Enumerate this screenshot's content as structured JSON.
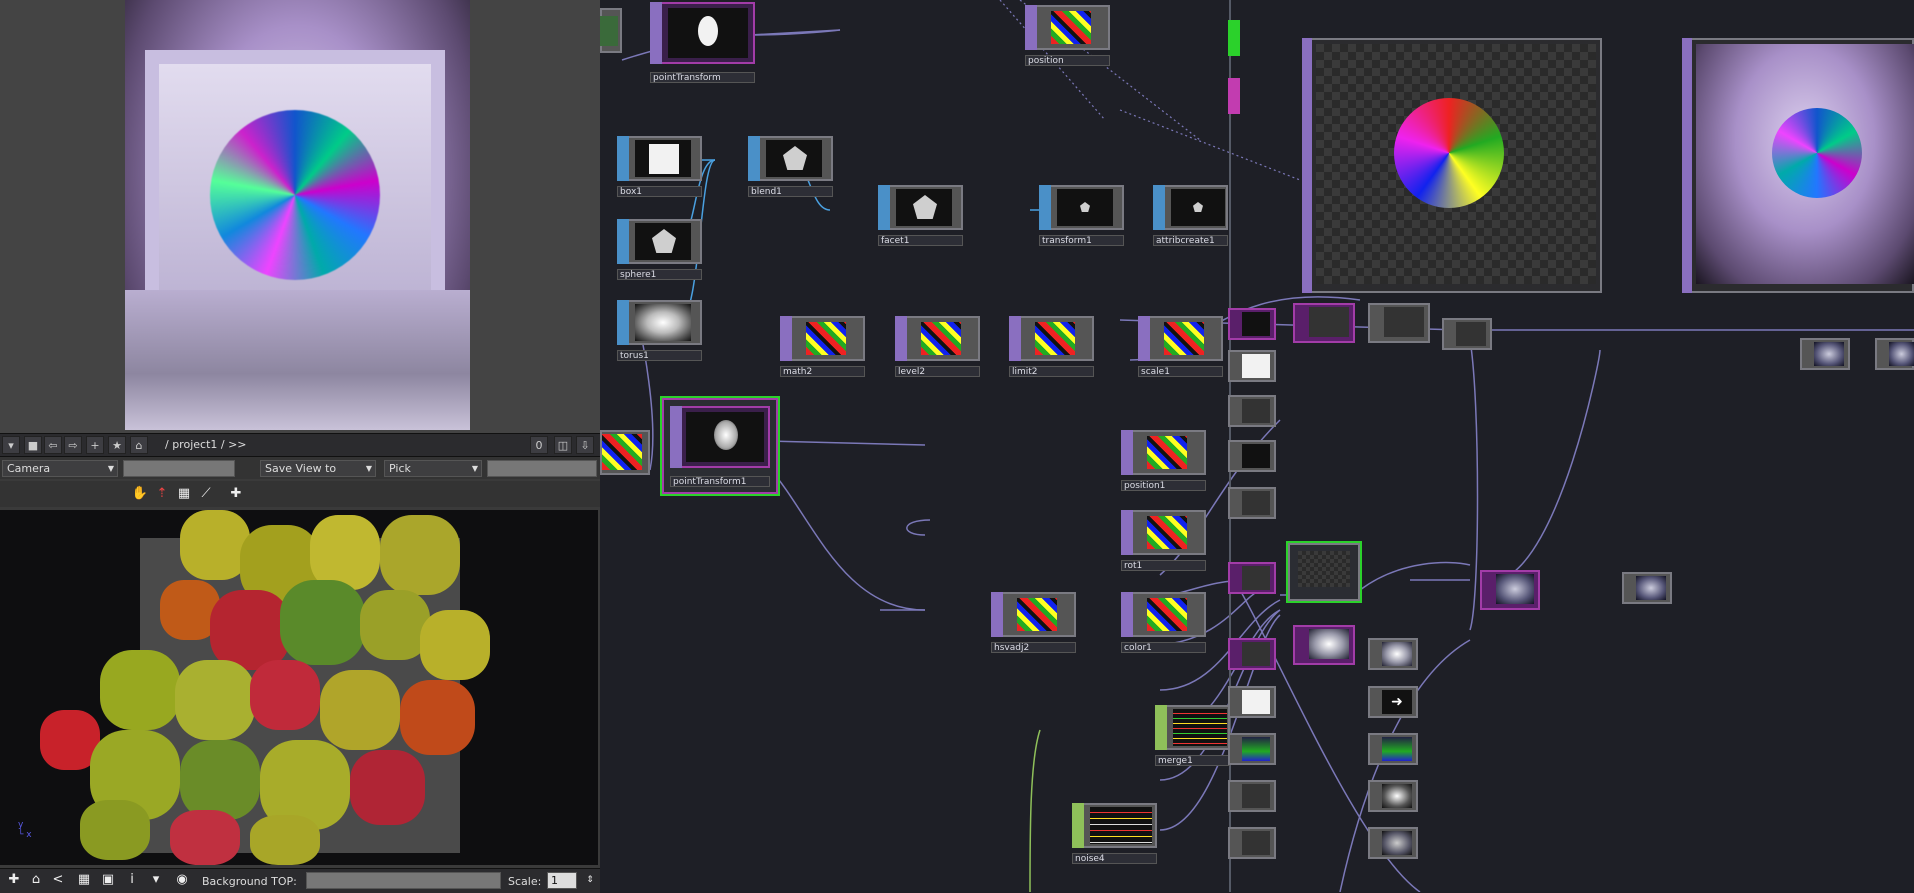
{
  "breadcrumb": "/ project1 / >>",
  "breadcrumb_counter": "0",
  "viewer": {
    "camera_select": "Camera",
    "save_view": "Save View to",
    "pick_select": "Pick"
  },
  "bottom_bar": {
    "background_label": "Background TOP:",
    "scale_label": "Scale:",
    "scale_value": "1"
  },
  "nodes": {
    "pointTransform": "pointTransform",
    "position": "position",
    "box1": "box1",
    "blend1": "blend1",
    "facet1": "facet1",
    "transform1": "transform1",
    "attribcreate1": "attribcreate1",
    "sphere1": "sphere1",
    "torus1": "torus1",
    "math2": "math2",
    "level2": "level2",
    "limit2": "limit2",
    "scale1": "scale1",
    "pointTransform1": "pointTransform1",
    "position1": "position1",
    "rot1": "rot1",
    "hsvadj2": "hsvadj2",
    "color1": "color1",
    "merge1": "merge1",
    "noise4": "noise4"
  },
  "colors": {
    "top_node": "#8a6fc0",
    "sop_node": "#4a90c8",
    "chop_node": "#8fc05a",
    "selected": "#2bd12b",
    "wire": "#7b78b8",
    "wire_sop": "#4aa0e0"
  }
}
